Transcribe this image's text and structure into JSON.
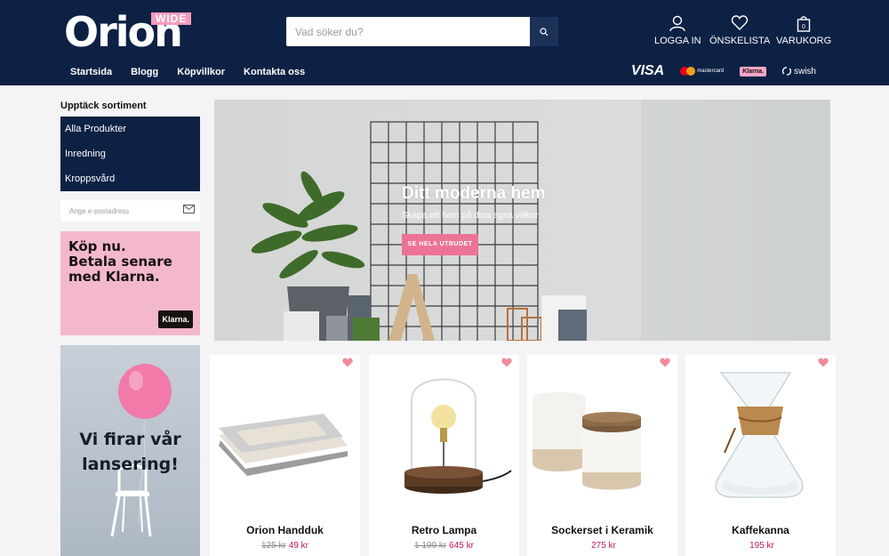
{
  "brand": {
    "logo_text": "Orion",
    "logo_badge": "WIDE"
  },
  "search": {
    "placeholder": "Vad söker du?"
  },
  "header_actions": {
    "login": "LOGGA IN",
    "wishlist": "ÖNSKELISTA",
    "cart": "VARUKORG",
    "cart_count": "0"
  },
  "nav": [
    "Startsida",
    "Blogg",
    "Köpvillkor",
    "Kontakta oss"
  ],
  "payments": {
    "visa": "VISA",
    "mastercard": "mastercard",
    "klarna": "Klarna.",
    "swish": "swish"
  },
  "sidebar": {
    "title": "Upptäck sortiment",
    "categories": [
      "Alla Produkter",
      "Inredning",
      "Kroppsvård"
    ],
    "newsletter_placeholder": "Ange e-postadress"
  },
  "klarna_ad": {
    "text": "Köp nu.\nBetala senare\nmed Klarna.",
    "logo": "Klarna."
  },
  "launch_ad": {
    "text": "Vi firar vår\nlansering!"
  },
  "hero": {
    "title": "Ditt moderna hem",
    "subtitle": "Skapa ett hem på dina egna villkor",
    "cta": "SE HELA UTBUDET"
  },
  "products": [
    {
      "name": "Orion Handduk",
      "old_price": "125 kr",
      "price": "49 kr"
    },
    {
      "name": "Retro Lampa",
      "old_price": "1 199 kr",
      "price": "645 kr"
    },
    {
      "name": "Sockerset i Keramik",
      "old_price": "",
      "price": "275 kr"
    },
    {
      "name": "Kaffekanna",
      "old_price": "",
      "price": "195 kr"
    }
  ],
  "colors": {
    "header_bg": "#0c2144",
    "accent_pink": "#ed7395",
    "price_red": "#c2185b",
    "klarna_pink": "#f4b8cc"
  }
}
